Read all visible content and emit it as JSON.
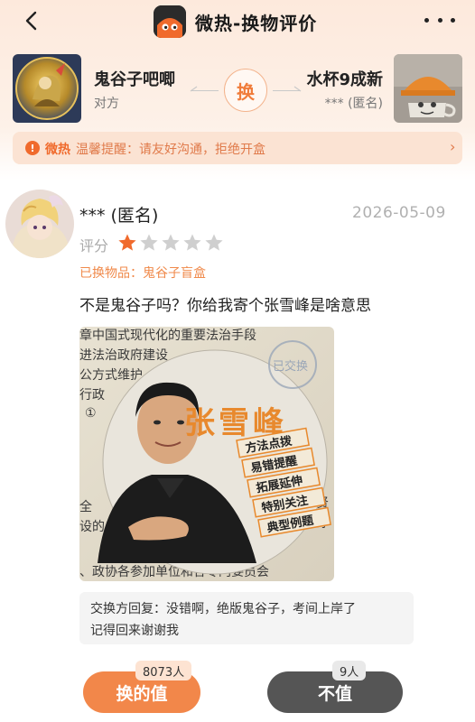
{
  "header": {
    "title": "微热-换物评价",
    "back_icon": "chevron-left-icon",
    "more_icon": "more-dots-icon"
  },
  "exchange": {
    "left_name": "鬼谷子吧唧",
    "left_sub": "对方",
    "swap_label": "换",
    "right_name": "水杯9成新",
    "right_sub": "*** (匿名)"
  },
  "notice": {
    "brand": "微热",
    "text": "温馨提醒：请友好沟通，拒绝开盒"
  },
  "review": {
    "name": "*** (匿名)",
    "date": "2026-05-09",
    "rating_label": "评分",
    "rating": 1,
    "rating_max": 5,
    "item_line": "已换物品：鬼谷子盲盒",
    "comment": "不是鬼谷子吗？你给我寄个张雪峰是啥意思",
    "photo": {
      "name_text": "张雪峰",
      "stamp_text": "已交换",
      "tags": [
        "方法点拨",
        "易错提醒",
        "拓展延伸",
        "特别关注",
        "典型例题"
      ],
      "bg_lines": [
        "章中国式现代化的重要法治手段",
        "进法治政府建设",
        "公方式维护",
        "行政",
        "①",
        "全",
        "设的",
        "、政协各参加单位和各专门委员会"
      ]
    },
    "reply_line1": "交换方回复：没错啊，绝版鬼谷子，考间上岸了",
    "reply_line2": "记得回来谢谢我"
  },
  "actions": {
    "worth_label": "换的值",
    "worth_count": "8073人",
    "notworth_label": "不值",
    "notworth_count": "9人"
  },
  "colors": {
    "accent": "#f2874a",
    "star_active": "#f06a2c",
    "star_inactive": "#cfcfcf"
  }
}
